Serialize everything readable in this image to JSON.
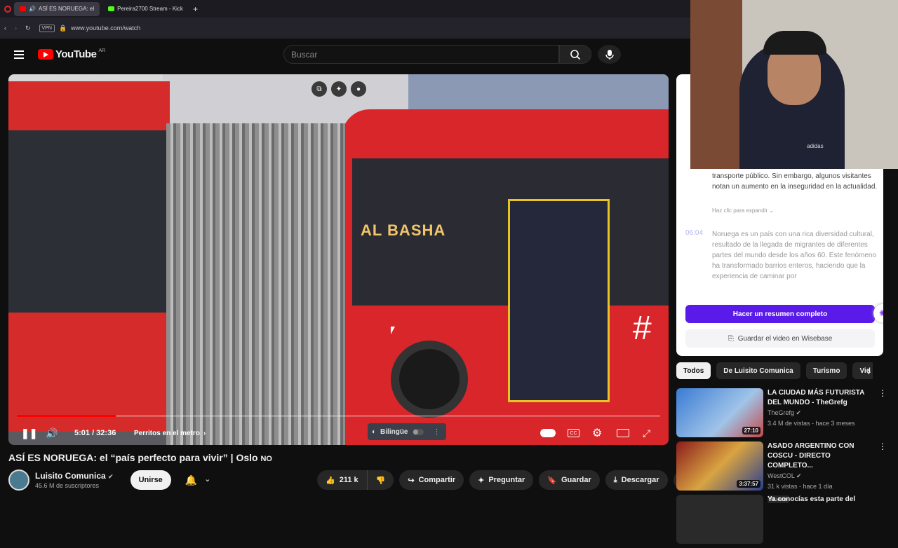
{
  "browser": {
    "tabs": [
      {
        "label": "ASÍ ES NORUEGA: el",
        "favicon_color": "#ff0000",
        "active": true
      },
      {
        "label": "Pereira2700 Stream - Kick",
        "favicon_color": "#53fc18",
        "active": false
      }
    ],
    "vpn_label": "VPN",
    "url": "www.youtube.com/watch"
  },
  "youtube": {
    "logo_text": "YouTube",
    "country": "AR",
    "search_placeholder": "Buscar"
  },
  "player": {
    "overlay_sign": "AL BASHA",
    "time": "5:01 / 32:36",
    "chapter": "Perritos en el metro",
    "progress": 0.154,
    "bilingue_label": "Bilingüe"
  },
  "video": {
    "title": "ASÍ ES NORUEGA: el “país perfecto para vivir” | Oslo",
    "flag": "NO",
    "channel": "Luisito Comunica",
    "subscribers": "45.6 M de suscriptores",
    "join": "Unirse",
    "likes": "211 k",
    "share": "Compartir",
    "ask": "Preguntar",
    "save": "Guardar",
    "download": "Descargar"
  },
  "webcam": {
    "brand": "adidas"
  },
  "summary": {
    "para1": "transporte público. Sin embargo, algunos visitantes notan un aumento en la inseguridad en la actualidad.",
    "expand": "Haz clic para expandir",
    "timestamp": "06:04",
    "para2": "Noruega es un país con una rica diversidad cultural, resultado de la llegada de migrantes de diferentes partes del mundo desde los años 60. Este fenómeno ha transformado barrios enteros, haciendo que la experiencia de caminar por",
    "cta": "Hacer un resumen completo",
    "save": "Guardar el video en Wisebase",
    "accent": "#5a1aea"
  },
  "chips": [
    "Todos",
    "De Luisito Comunica",
    "Turismo",
    "Vid"
  ],
  "recommendations": [
    {
      "title": "LA CIUDAD MÁS FUTURISTA DEL MUNDO - TheGrefg",
      "channel": "TheGrefg",
      "meta": "3.4 M de vistas - hace 3 meses",
      "duration": "27:10",
      "badge": ""
    },
    {
      "title": "ASADO ARGENTINO CON COSCU - DIRECTO COMPLETO...",
      "channel": "WestCOL",
      "meta": "31 k vistas - hace 1 día",
      "duration": "3:37:57",
      "badge": "Nuevo"
    },
    {
      "title": "Ya conocías esta parte del",
      "channel": "",
      "meta": "",
      "duration": "",
      "badge": ""
    }
  ]
}
